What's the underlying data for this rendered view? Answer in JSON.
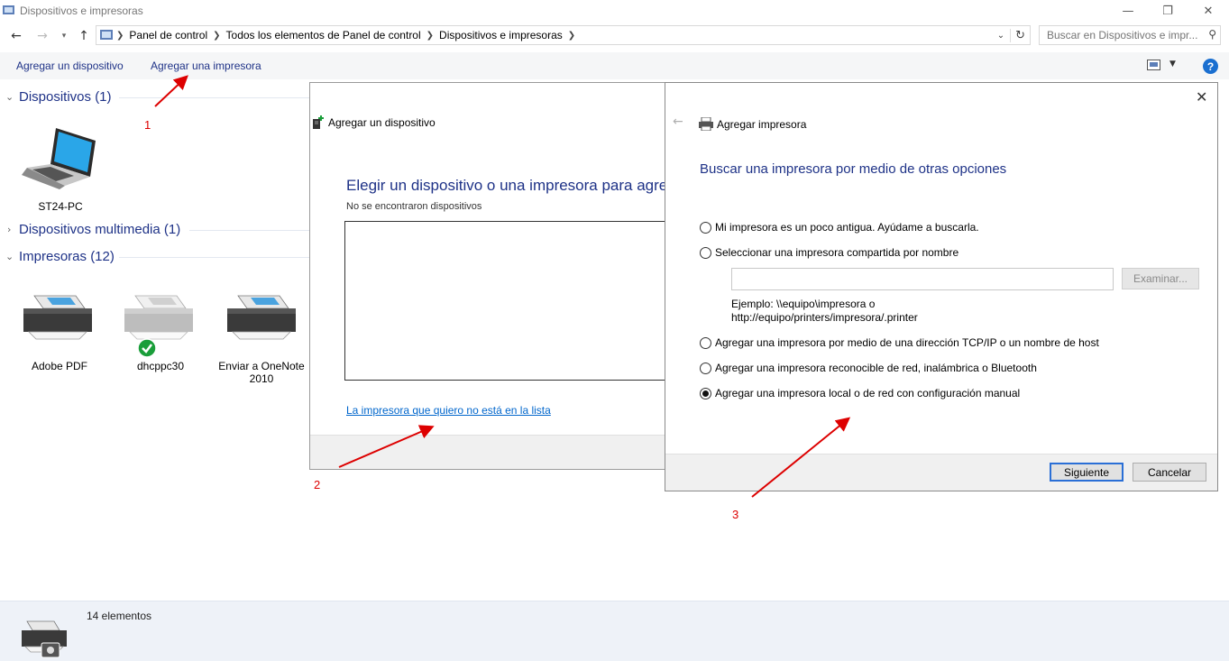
{
  "window": {
    "title": "Dispositivos e impresoras",
    "minimize_glyph": "—",
    "restore_glyph": "❐",
    "close_glyph": "✕"
  },
  "address": {
    "crumbs": [
      "Panel de control",
      "Todos los elementos de Panel de control",
      "Dispositivos e impresoras"
    ],
    "search_placeholder": "Buscar en Dispositivos e impr..."
  },
  "toolbar": {
    "add_device": "Agregar un dispositivo",
    "add_printer": "Agregar una impresora",
    "help": "?"
  },
  "groups": {
    "devices": {
      "label": "Dispositivos (1)",
      "items": [
        "ST24-PC"
      ]
    },
    "multimedia": {
      "label": "Dispositivos multimedia (1)"
    },
    "printers": {
      "label": "Impresoras (12)",
      "items": [
        "Adobe PDF",
        "dhcppc30",
        "Enviar a OneNote 2010"
      ]
    }
  },
  "status": {
    "count": "14 elementos"
  },
  "dialog_add_device": {
    "title": "Agregar un dispositivo",
    "heading": "Elegir un dispositivo o una impresora para agre",
    "subtitle": "No se encontraron dispositivos",
    "link": "La impresora que quiero no está en la lista"
  },
  "dialog_add_printer": {
    "title": "Agregar impresora",
    "heading": "Buscar una impresora por medio de otras opciones",
    "options": [
      "Mi impresora es un poco antigua. Ayúdame a buscarla.",
      "Seleccionar una impresora compartida por nombre",
      "Agregar una impresora por medio de una dirección TCP/IP o un nombre de host",
      "Agregar una impresora reconocible de red, inalámbrica o Bluetooth",
      "Agregar una impresora local o de red con configuración manual"
    ],
    "selected_option": 4,
    "browse_label": "Examinar...",
    "example_line1": "Ejemplo: \\\\equipo\\impresora o",
    "example_line2": "http://equipo/printers/impresora/.printer",
    "next_label": "Siguiente",
    "cancel_label": "Cancelar"
  },
  "annotations": [
    "1",
    "2",
    "3"
  ],
  "colors": {
    "accent_blue": "#1e3287",
    "link": "#0066cc",
    "annotation_red": "#dd0000",
    "status_green": "#1a9e3a"
  }
}
